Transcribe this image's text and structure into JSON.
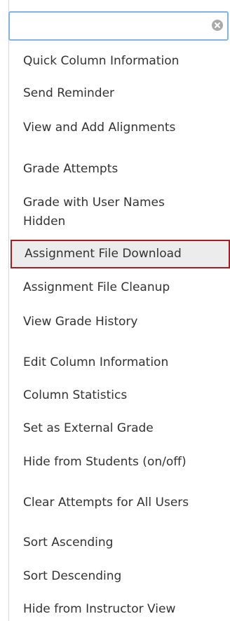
{
  "search": {
    "value": "",
    "placeholder": ""
  },
  "menu": {
    "items": [
      {
        "label": "Quick Column Information"
      },
      {
        "label": "Send Reminder"
      },
      {
        "label": "View and Add Alignments"
      },
      {
        "label": "Grade Attempts"
      },
      {
        "label": "Grade with User Names Hidden"
      },
      {
        "label": "Assignment File Download",
        "selected": true
      },
      {
        "label": "Assignment File Cleanup"
      },
      {
        "label": "View Grade History"
      },
      {
        "label": "Edit Column Information"
      },
      {
        "label": "Column Statistics"
      },
      {
        "label": "Set as External Grade"
      },
      {
        "label": "Hide from Students (on/off)"
      },
      {
        "label": "Clear Attempts for All Users"
      },
      {
        "label": "Sort Ascending"
      },
      {
        "label": "Sort Descending"
      },
      {
        "label": "Hide from Instructor View"
      }
    ]
  },
  "colors": {
    "search_border": "#7fb3ea",
    "selected_border": "#a41e22",
    "selected_bg": "#ececec"
  }
}
